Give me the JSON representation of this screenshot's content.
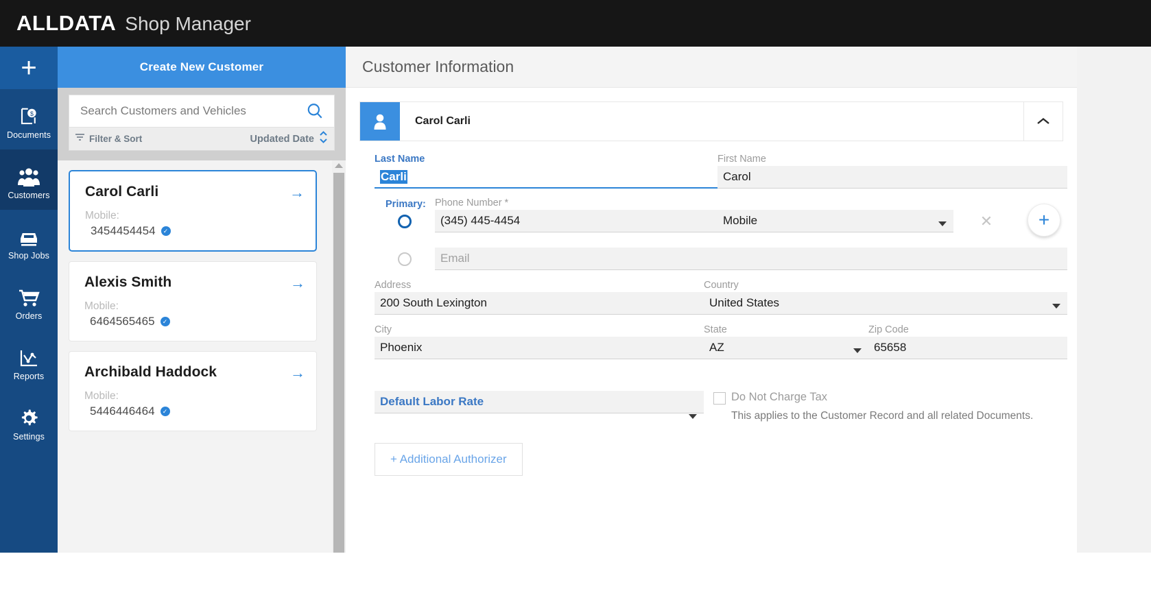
{
  "topbar": {
    "brand_primary": "ALLDATA",
    "brand_secondary": "Shop Manager"
  },
  "sidebar": {
    "add_label": "+",
    "items": [
      {
        "label": "Documents",
        "icon": "document-dollar-icon",
        "active": false
      },
      {
        "label": "Customers",
        "icon": "people-icon",
        "active": true
      },
      {
        "label": "Shop Jobs",
        "icon": "car-icon",
        "active": false
      },
      {
        "label": "Orders",
        "icon": "cart-icon",
        "active": false
      },
      {
        "label": "Reports",
        "icon": "chart-icon",
        "active": false
      },
      {
        "label": "Settings",
        "icon": "gear-icon",
        "active": false
      }
    ]
  },
  "customer_list": {
    "header": "Create New Customer",
    "search": {
      "placeholder": "Search Customers and Vehicles",
      "value": "",
      "icon": "search-icon"
    },
    "filter": {
      "label": "Filter & Sort",
      "icon": "filter-icon"
    },
    "sort": {
      "label": "Updated Date",
      "icon": "sort-updown-icon"
    },
    "cards": [
      {
        "name": "Carol Carli",
        "phone_type": "Mobile:",
        "phone": "3454454454",
        "verified": true,
        "selected": true,
        "arrow": "→"
      },
      {
        "name": "Alexis Smith",
        "phone_type": "Mobile:",
        "phone": "6464565465",
        "verified": true,
        "selected": false,
        "arrow": "→"
      },
      {
        "name": "Archibald Haddock",
        "phone_type": "Mobile:",
        "phone": "5446446464",
        "verified": true,
        "selected": false,
        "arrow": "→"
      }
    ]
  },
  "main": {
    "title": "Customer Information",
    "customer_bar": {
      "avatar_icon": "person-icon",
      "name": "Carol Carli",
      "collapse_icon": "chevron-up-icon"
    },
    "form": {
      "last_name": {
        "label": "Last Name",
        "value": "Carli",
        "selected": true
      },
      "first_name": {
        "label": "First Name",
        "value": "Carol"
      },
      "primary_label": "Primary:",
      "phone": {
        "label": "Phone Number *",
        "value": "(345) 445-4454",
        "type_value": "Mobile",
        "remove_icon": "close-icon",
        "add_icon": "plus-icon"
      },
      "email": {
        "placeholder": "Email",
        "value": ""
      },
      "address": {
        "label": "Address",
        "value": "200 South Lexington"
      },
      "country": {
        "label": "Country",
        "value": "United States"
      },
      "city": {
        "label": "City",
        "value": "Phoenix"
      },
      "state": {
        "label": "State",
        "value": "AZ"
      },
      "zip": {
        "label": "Zip Code",
        "value": "65658"
      },
      "labor_rate": {
        "value": "Default Labor Rate"
      },
      "tax": {
        "label": "Do Not Charge Tax",
        "checked": false,
        "note": "This applies to the Customer Record and all related Documents."
      },
      "additional_authorizer": "+ Additional Authorizer"
    }
  },
  "colors": {
    "brand_dark": "#161616",
    "rail_blue": "#164a82",
    "rail_active": "#123a68",
    "accent_blue": "#2b84d8",
    "header_blue": "#3b8fe0",
    "link_blue": "#3b78c4"
  }
}
